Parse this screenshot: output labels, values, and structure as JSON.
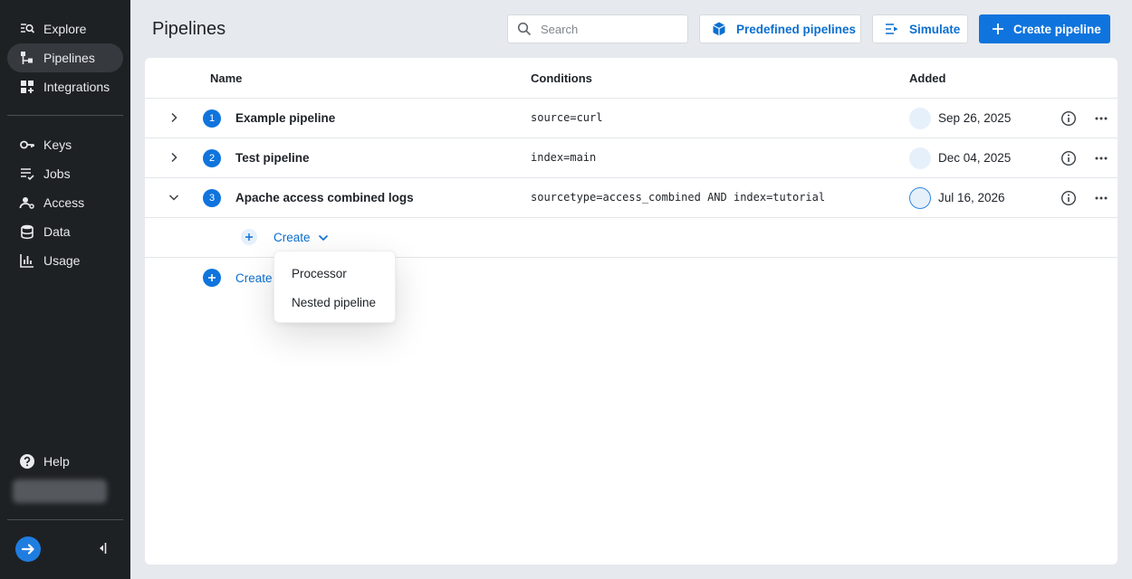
{
  "sidebar": {
    "items": [
      {
        "label": "Explore",
        "icon": "explore-icon"
      },
      {
        "label": "Pipelines",
        "icon": "pipelines-icon",
        "active": true
      },
      {
        "label": "Integrations",
        "icon": "integrations-icon"
      },
      {
        "label": "Keys",
        "icon": "key-icon"
      },
      {
        "label": "Jobs",
        "icon": "jobs-icon"
      },
      {
        "label": "Access",
        "icon": "access-icon"
      },
      {
        "label": "Data",
        "icon": "database-icon"
      },
      {
        "label": "Usage",
        "icon": "bar-chart-icon"
      }
    ],
    "help": {
      "label": "Help",
      "icon": "help-icon"
    }
  },
  "header": {
    "title": "Pipelines",
    "search": {
      "placeholder": "Search",
      "value": ""
    },
    "predefined_label": "Predefined pipelines",
    "simulate_label": "Simulate",
    "create_label": "Create pipeline"
  },
  "table": {
    "columns": {
      "name": "Name",
      "conditions": "Conditions",
      "added": "Added"
    },
    "rows": [
      {
        "num": "1",
        "name": "Example pipeline",
        "conditions": "source=curl",
        "added": "Sep 26, 2025",
        "expanded": false
      },
      {
        "num": "2",
        "name": "Test pipeline",
        "conditions": "index=main",
        "added": "Dec 04, 2025",
        "expanded": false
      },
      {
        "num": "3",
        "name": "Apache access combined logs",
        "conditions": "sourcetype=access_combined AND index=tutorial",
        "added": "Jul 16, 2026",
        "expanded": true
      }
    ],
    "sub_create_label": "Create",
    "bottom_create_label": "Create"
  },
  "dropdown": {
    "items": [
      "Processor",
      "Nested pipeline"
    ]
  },
  "colors": {
    "accent": "#0f74dd",
    "sidebar_bg": "#1e2124",
    "page_bg": "#e6e9ed"
  }
}
